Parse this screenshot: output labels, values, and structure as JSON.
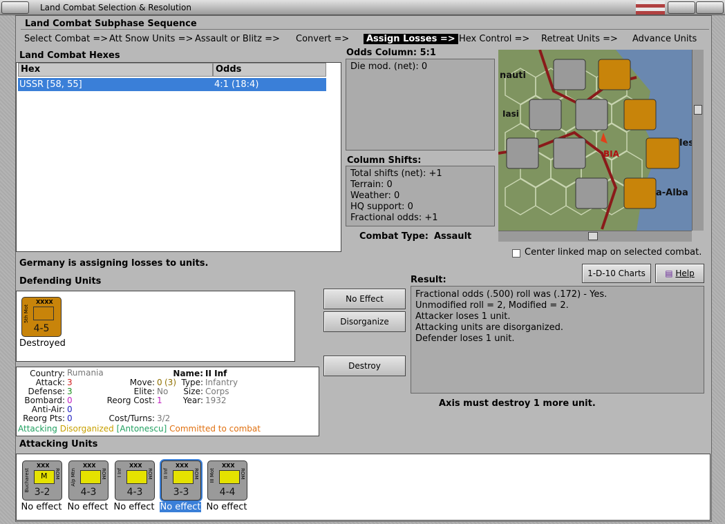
{
  "window": {
    "title": "Land Combat Selection & Resolution"
  },
  "sequence": {
    "title": "Land Combat Subphase Sequence",
    "steps": [
      "Select Combat =>",
      "Att Snow Units =>",
      "Assault or Blitz =>",
      "Convert =>",
      "Assign Losses =>",
      "Hex Control =>",
      "Retreat Units =>",
      "Advance Units"
    ],
    "active": "Assign Losses =>"
  },
  "hexes": {
    "title": "Land Combat Hexes",
    "col_hex": "Hex",
    "col_odds": "Odds",
    "rows": [
      {
        "hex": "USSR [58, 55]",
        "odds": "4:1 (18:4)"
      }
    ]
  },
  "odds": {
    "title": "Odds Column: 5:1",
    "die_mod": "Die mod. (net): 0"
  },
  "shifts": {
    "title": "Column Shifts:",
    "lines": [
      "Total shifts (net): +1",
      "Terrain: 0",
      "Weather: 0",
      "HQ support: 0",
      "Fractional odds: +1"
    ]
  },
  "combat_type": {
    "label": "Combat Type:",
    "value": "Assault"
  },
  "map": {
    "labels": [
      "nauti",
      "Iasi",
      "BIA",
      "les",
      "a-Alba"
    ],
    "center_linked": "Center linked map on selected combat."
  },
  "status": "Germany is assigning losses to units.",
  "buttons": {
    "charts": "1-D-10 Charts",
    "help": "Help",
    "no_effect": "No Effect",
    "disorganize": "Disorganize",
    "destroy": "Destroy"
  },
  "defending": {
    "title": "Defending Units",
    "units": [
      {
        "name": "5th Mot",
        "size": "XXXX",
        "strength": "4-5",
        "caption": "Destroyed"
      }
    ]
  },
  "result": {
    "title": "Result:",
    "lines": [
      "Fractional odds (.500) roll was (.172)  - Yes.",
      "Unmodified roll = 2, Modified = 2.",
      "Attacker loses 1 unit.",
      "Attacking units are disorganized.",
      "Defender loses 1 unit."
    ],
    "footer": "Axis must destroy 1 more unit."
  },
  "unit_info": {
    "country_label": "Country:",
    "country": "Rumania",
    "attack_label": "Attack:",
    "attack": "3",
    "defense_label": "Defense:",
    "defense": "3",
    "bombard_label": "Bombard:",
    "bombard": "0",
    "antiair_label": "Anti-Air:",
    "antiair": "0",
    "reorg_label": "Reorg Pts:",
    "reorg": "0",
    "name_label": "Name:",
    "name": "II Inf",
    "move_label": "Move:",
    "move": "0",
    "move2": "(3)",
    "type_label": "Type:",
    "type": "Infantry",
    "elite_label": "Elite:",
    "elite": "No",
    "size_label": "Size:",
    "size": "Corps",
    "reorgcost_label": "Reorg Cost:",
    "reorgcost": "1",
    "year_label": "Year:",
    "year": "1932",
    "costturns_label": "Cost/Turns:",
    "costturns": "3/2",
    "s1": "Attacking",
    "s2": "Disorganized",
    "s3": "[Antonescu]",
    "s4": "Committed to combat"
  },
  "attacking": {
    "title": "Attacking Units",
    "units": [
      {
        "name": "Bucharest",
        "nat": "ROM",
        "size": "XXX",
        "strength": "3-2",
        "caption": "No effect",
        "sym": "M"
      },
      {
        "name": "Alp Mtn",
        "nat": "ROM",
        "size": "XXX",
        "strength": "4-3",
        "caption": "No effect",
        "sym": ""
      },
      {
        "name": "I Inf",
        "nat": "ROM",
        "size": "XXX",
        "strength": "4-3",
        "caption": "No effect",
        "sym": ""
      },
      {
        "name": "II Inf",
        "nat": "ROM",
        "size": "XXX",
        "strength": "3-3",
        "caption": "No effect",
        "sym": ""
      },
      {
        "name": "III Mot",
        "nat": "ROM",
        "size": "XXX",
        "strength": "4-4",
        "caption": "No effect",
        "sym": ""
      }
    ]
  }
}
